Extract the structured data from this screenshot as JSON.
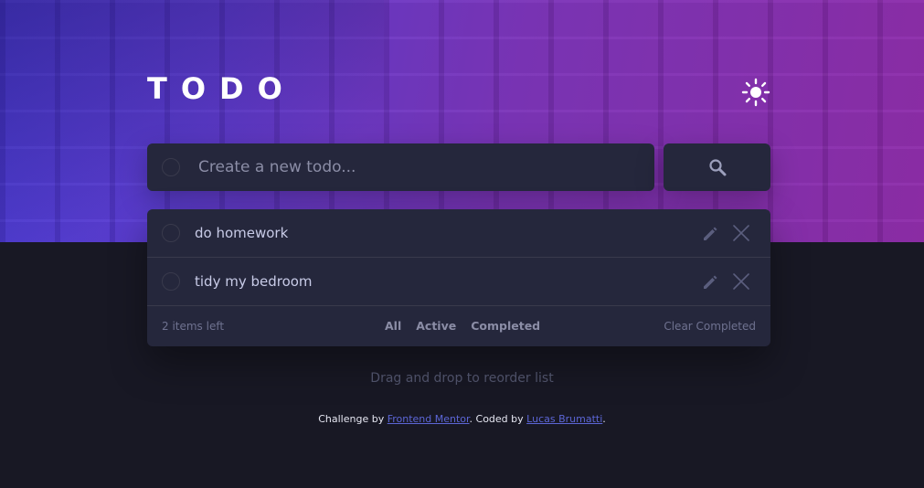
{
  "app": {
    "title": "TODO",
    "theme_icon": "sun-icon"
  },
  "new_todo": {
    "placeholder": "Create a new todo...",
    "value": "",
    "search_icon": "search-icon"
  },
  "todos": [
    {
      "text": "do homework",
      "completed": false
    },
    {
      "text": "tidy my bedroom",
      "completed": false
    }
  ],
  "footer_bar": {
    "items_left": "2 items left",
    "filters": [
      "All",
      "Active",
      "Completed"
    ],
    "clear": "Clear Completed"
  },
  "hint": "Drag and drop to reorder list",
  "credits": {
    "prefix": "Challenge by ",
    "link1": "Frontend Mentor",
    "middle": ". Coded by ",
    "link2": "Lucas Brumatti",
    "suffix": "."
  },
  "colors": {
    "hero_gradient_start": "#4b3bd6",
    "hero_gradient_end": "#8d2aa8",
    "background": "#181824",
    "card": "#25273c",
    "accent_link": "#5c66d6"
  }
}
